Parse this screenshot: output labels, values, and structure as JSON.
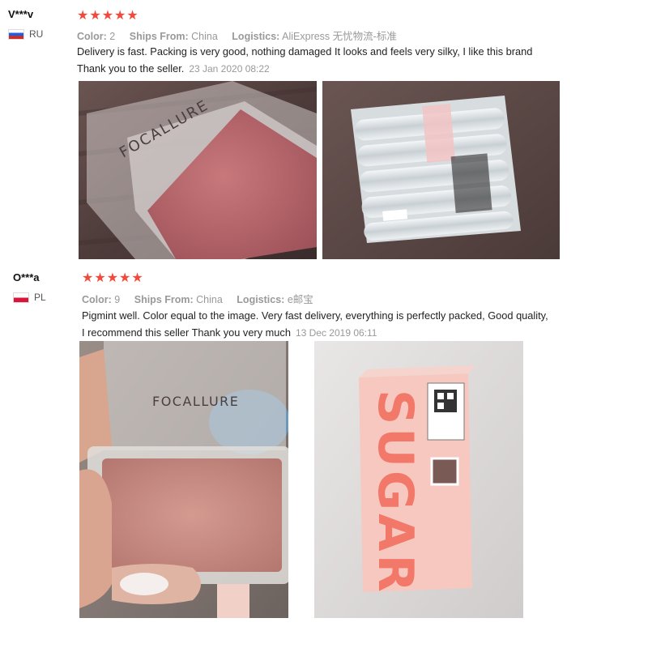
{
  "reviews": [
    {
      "user": "V***v",
      "country": "RU",
      "stars": "★★★★★",
      "rating": 5,
      "color_label": "Color:",
      "color_value": "2",
      "ships_label": "Ships From:",
      "ships_value": "China",
      "logistics_label": "Logistics:",
      "logistics_value": "AliExpress 无忧物流-标准",
      "text_line1": "Delivery is fast. Packing is very good, nothing damaged  It looks and feels very silky, I like this brand",
      "text_line2": "Thank you to the seller.",
      "date": "23 Jan 2020 08:22",
      "photo1_brand": "FOCALLURE"
    },
    {
      "user": "O***a",
      "country": "PL",
      "stars": "★★★★★",
      "rating": 5,
      "color_label": "Color:",
      "color_value": "9",
      "ships_label": "Ships From:",
      "ships_value": "China",
      "logistics_label": "Logistics:",
      "logistics_value": "e邮宝",
      "text_line1": "Pigmint well. Color equal to the image. Very fast delivery, everything is perfectly packed, Good quality,",
      "text_line2": "I recommend this seller Thank you very much",
      "date": "13 Dec 2019 06:11",
      "photo1_brand": "FOCALLURE",
      "photo2_title": "SUGAR"
    }
  ],
  "colors": {
    "star": "#f2493b",
    "meta": "#999999"
  }
}
